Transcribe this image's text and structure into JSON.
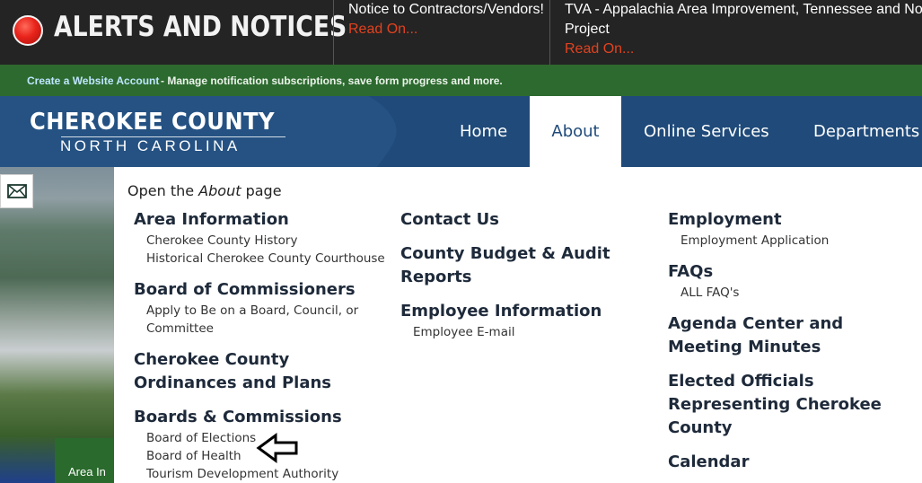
{
  "alerts": {
    "title": "ALERTS AND NOTICES",
    "notices": [
      {
        "text": "Notice to Contractors/Vendors!",
        "link": "Read On..."
      },
      {
        "text": "TVA - Appalachia Area Improvement, Tennessee and No Project",
        "link": "Read On..."
      }
    ]
  },
  "account_bar": {
    "link": "Create a Website Account",
    "text": "- Manage notification subscriptions, save form progress and more."
  },
  "logo": {
    "line1": "CHEROKEE COUNTY",
    "line2": "NORTH CAROLINA"
  },
  "nav": {
    "home": "Home",
    "about": "About",
    "online_services": "Online Services",
    "departments": "Departments"
  },
  "side": {
    "area_label": "Area In"
  },
  "menu": {
    "open_prefix": "Open the",
    "open_page": "About",
    "open_suffix": "page",
    "col1": [
      {
        "heading": "Area Information",
        "items": [
          "Cherokee County History",
          "Historical Cherokee County Courthouse"
        ]
      },
      {
        "heading": "Board of Commissioners",
        "items": [
          "Apply to Be on a Board, Council, or Committee"
        ]
      },
      {
        "heading": "Cherokee County Ordinances and Plans",
        "items": []
      },
      {
        "heading": "Boards & Commissions",
        "items": [
          "Board of Elections",
          "Board of Health",
          "Tourism Development Authority"
        ]
      }
    ],
    "col2": [
      {
        "heading": "Contact Us",
        "items": []
      },
      {
        "heading": "County Budget & Audit Reports",
        "items": []
      },
      {
        "heading": "Employee Information",
        "items": [
          "Employee E-mail"
        ]
      }
    ],
    "col3": [
      {
        "heading": "Employment",
        "items": [
          "Employment Application"
        ]
      },
      {
        "heading": "FAQs",
        "items": [
          "ALL FAQ's"
        ]
      },
      {
        "heading": "Agenda Center and Meeting Minutes",
        "items": []
      },
      {
        "heading": "Elected Officials Representing Cherokee County",
        "items": []
      },
      {
        "heading": "Calendar",
        "items": []
      }
    ]
  },
  "colors": {
    "alert_bg": "#242424",
    "green_bar": "#2d6a2f",
    "header_blue": "#1f4a79",
    "read_on": "#e2421f"
  }
}
